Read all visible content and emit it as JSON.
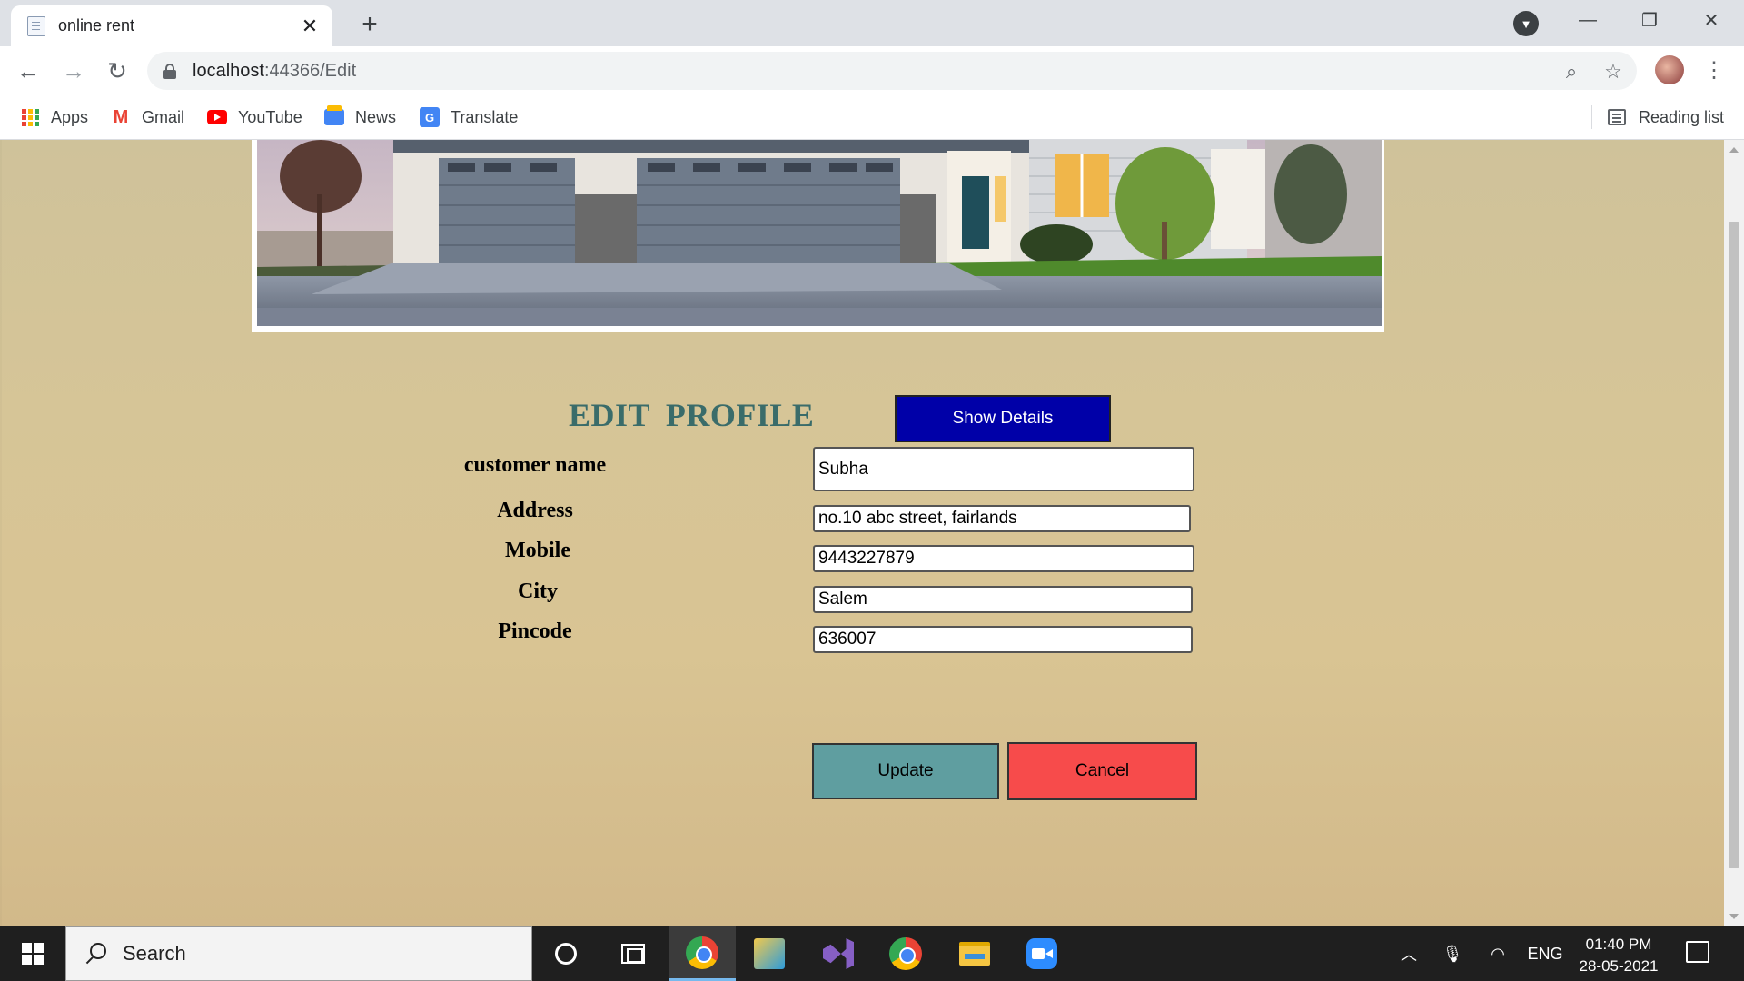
{
  "browser": {
    "tab_title": "online rent",
    "url_host": "localhost",
    "url_path": ":44366/Edit",
    "bookmarks": [
      "Apps",
      "Gmail",
      "YouTube",
      "News",
      "Translate"
    ],
    "reading_list": "Reading list"
  },
  "page": {
    "heading": "EDIT  PROFILE",
    "show_details_label": "Show Details",
    "fields": {
      "customer_name": {
        "label": "customer name",
        "value": "Subha"
      },
      "address": {
        "label": "Address",
        "value": "no.10 abc street, fairlands"
      },
      "mobile": {
        "label": "Mobile",
        "value": "9443227879"
      },
      "city": {
        "label": "City",
        "value": "Salem"
      },
      "pincode": {
        "label": "Pincode",
        "value": "636007"
      }
    },
    "update_label": "Update",
    "cancel_label": "Cancel"
  },
  "taskbar": {
    "search_placeholder": "Search",
    "language": "ENG",
    "time": "01:40 PM",
    "date": "28-05-2021"
  },
  "colors": {
    "show_details_bg": "#0000a8",
    "heading": "#3a6c6a",
    "update_bg": "#5f9ea0",
    "cancel_bg": "#f74b4b"
  }
}
